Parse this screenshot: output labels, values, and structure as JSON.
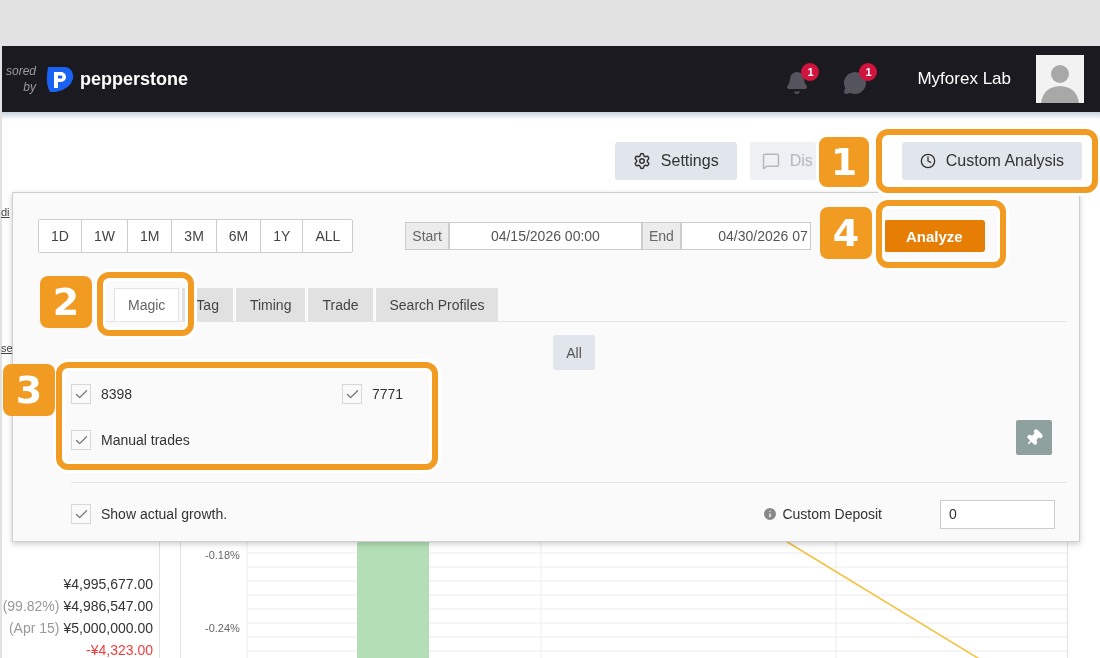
{
  "header": {
    "sponsor_text": "sored by",
    "brand": "pepperstone",
    "notification_count": "1",
    "message_count": "1",
    "user_name": "Myforex Lab"
  },
  "toolbar": [
    {
      "label": "Settings",
      "kind": "settings",
      "disabled": false
    },
    {
      "label": "Dis",
      "kind": "discuss",
      "disabled": true
    },
    {
      "label": "Custom Analysis",
      "kind": "clock",
      "disabled": false
    }
  ],
  "panel": {
    "periods": [
      "1D",
      "1W",
      "1M",
      "3M",
      "6M",
      "1Y",
      "ALL"
    ],
    "start_label": "Start",
    "start_value": "04/15/2026 00:00",
    "end_label": "End",
    "end_value": "04/30/2026 07",
    "analyze_button": "Analyze",
    "tabs": [
      {
        "label": "Magic",
        "selected": true
      },
      {
        "label": "Tag",
        "selected": false
      },
      {
        "label": "Timing",
        "selected": false
      },
      {
        "label": "Trade",
        "selected": false
      },
      {
        "label": "Search Profiles",
        "selected": false
      }
    ],
    "all_button": "All",
    "magic_options": [
      {
        "label": "8398",
        "checked": true
      },
      {
        "label": "7771",
        "checked": true
      },
      {
        "label": "Manual trades",
        "checked": true
      }
    ],
    "show_actual_growth": {
      "label": "Show actual growth.",
      "checked": true
    },
    "custom_deposit": {
      "label": "Custom Deposit",
      "value": "0"
    }
  },
  "background": {
    "fragments": [
      "di",
      "se"
    ],
    "summary": [
      {
        "value": "¥4,995,677.00",
        "kind": "normal"
      },
      {
        "note": "(99.82%)",
        "value": "¥4,986,547.00",
        "kind": "normal"
      },
      {
        "note": "(Apr 15)",
        "value": "¥5,000,000.00",
        "kind": "normal"
      },
      {
        "value": "-¥4,323.00",
        "kind": "negative"
      }
    ],
    "chart_axis_labels": [
      "-0.18%",
      "-0.24%"
    ]
  },
  "callouts": [
    "1",
    "2",
    "3",
    "4"
  ]
}
